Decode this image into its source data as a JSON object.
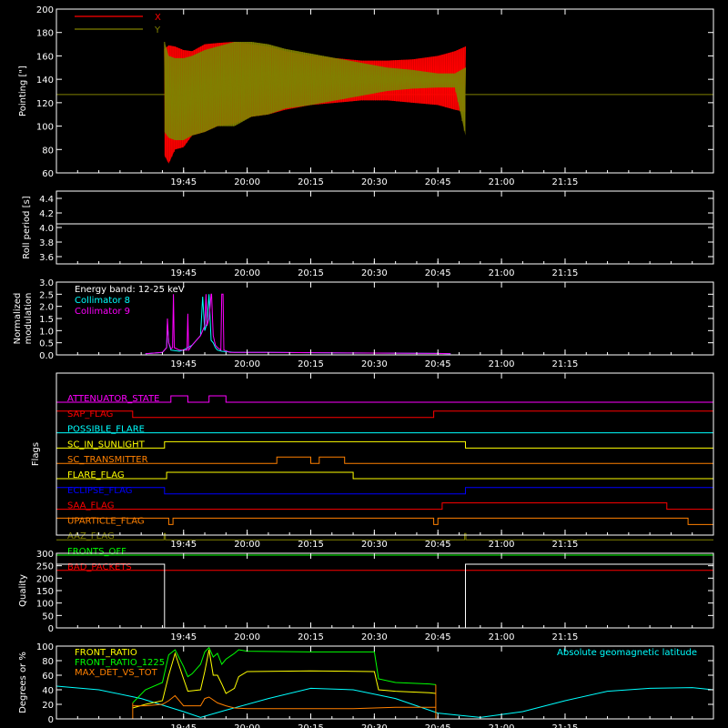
{
  "time_axis": {
    "range_min": [
      -30,
      125
    ],
    "tick_labels": [
      "19:45",
      "20:00",
      "20:15",
      "20:30",
      "20:45",
      "21:00",
      "21:15"
    ],
    "tick_values_min": [
      0,
      15,
      30,
      45,
      60,
      75,
      90
    ]
  },
  "colors": {
    "background": "#000000",
    "axes": "#ffffff",
    "red": "#ff0000",
    "olive": "#808000",
    "cyan": "#00ffff",
    "magenta": "#ff00ff",
    "yellow": "#ffff00",
    "green": "#00ff00",
    "orange": "#ff8000",
    "blue": "#0000ff"
  },
  "chart_data": [
    {
      "id": "pointing",
      "type": "line",
      "ylabel": "Pointing [\"]",
      "ylim": [
        60,
        200
      ],
      "ytick_labels": [
        "60",
        "80",
        "100",
        "120",
        "140",
        "160",
        "180",
        "200"
      ],
      "legend": [
        {
          "name": "X",
          "color": "#ff0000"
        },
        {
          "name": "Y",
          "color": "#808000"
        }
      ],
      "reference_line": 127,
      "series": [
        {
          "name": "X",
          "color": "#ff0000",
          "x": [
            -4.5,
            -3.5,
            -2,
            0,
            2,
            5,
            8,
            12,
            16,
            20,
            24,
            30,
            36,
            42,
            48,
            54,
            60,
            62,
            64,
            66.5
          ],
          "upper": [
            166,
            169,
            168,
            165,
            164,
            170,
            171,
            172,
            170,
            168,
            164,
            160,
            158,
            156,
            156,
            157,
            160,
            162,
            164,
            168
          ],
          "lower": [
            75,
            68,
            80,
            82,
            92,
            95,
            100,
            102,
            108,
            110,
            114,
            118,
            120,
            122,
            122,
            120,
            118,
            116,
            114,
            112
          ]
        },
        {
          "name": "Y",
          "color": "#808000",
          "x": [
            -4.5,
            -3.5,
            -2,
            0,
            2,
            5,
            8,
            12,
            16,
            20,
            24,
            30,
            36,
            42,
            48,
            54,
            60,
            62,
            64,
            66.5
          ],
          "upper": [
            172,
            160,
            158,
            158,
            160,
            165,
            168,
            172,
            172,
            170,
            166,
            162,
            158,
            154,
            150,
            148,
            145,
            145,
            145,
            150
          ],
          "lower": [
            95,
            90,
            88,
            88,
            92,
            95,
            100,
            100,
            108,
            110,
            115,
            118,
            122,
            126,
            130,
            132,
            133,
            133,
            133,
            92
          ]
        }
      ]
    },
    {
      "id": "roll-period",
      "type": "line",
      "ylabel": "Roll period [s]",
      "ylim": [
        3.5,
        4.5
      ],
      "ytick_labels": [
        "3.6",
        "3.8",
        "4.0",
        "4.2",
        "4.4"
      ],
      "series": [
        {
          "color": "#ffffff",
          "x": [
            -30,
            125
          ],
          "y": [
            4.05,
            4.05
          ]
        }
      ]
    },
    {
      "id": "modulation",
      "type": "line",
      "ylabel": "Normalized modulation",
      "ylim": [
        0,
        3
      ],
      "ytick_labels": [
        "0.0",
        "0.5",
        "1.0",
        "1.5",
        "2.0",
        "2.5",
        "3.0"
      ],
      "annotations": [
        "Energy band: 12-25 keV"
      ],
      "legend": [
        {
          "name": "Collimator 8",
          "color": "#00ffff"
        },
        {
          "name": "Collimator 9",
          "color": "#ff00ff"
        }
      ],
      "series": [
        {
          "name": "Collimator 8",
          "color": "#00ffff",
          "x": [
            -9,
            -5,
            -4,
            -3.8,
            -3.5,
            -3,
            -1,
            0,
            2,
            4,
            4.5,
            5,
            5.5,
            6,
            6.5,
            7,
            7.5,
            8,
            9,
            12,
            20,
            40,
            60,
            63
          ],
          "y": [
            0.05,
            0.1,
            0.3,
            1.3,
            0.5,
            0.2,
            0.15,
            0.2,
            0.4,
            0.8,
            2.4,
            1.0,
            1.3,
            2.5,
            0.6,
            0.5,
            0.3,
            0.2,
            0.15,
            0.1,
            0.1,
            0.08,
            0.06,
            0.05
          ]
        },
        {
          "name": "Collimator 9",
          "color": "#ff00ff",
          "x": [
            -9,
            -5,
            -4,
            -3.8,
            -3.5,
            -3,
            -2.6,
            -2.4,
            -2.2,
            -1,
            0.8,
            1,
            1.2,
            2,
            4,
            5,
            5.3,
            5.5,
            6,
            6.5,
            6.6,
            7,
            7.5,
            8,
            8.8,
            9,
            9.3,
            9.5,
            11,
            20,
            40,
            60,
            63
          ],
          "y": [
            0.05,
            0.1,
            0.3,
            1.5,
            0.5,
            0.25,
            0.3,
            2.5,
            0.3,
            0.2,
            0.2,
            1.7,
            0.2,
            0.4,
            0.8,
            1.2,
            2.5,
            1.2,
            1.5,
            2.5,
            2.5,
            0.8,
            0.4,
            0.3,
            0.2,
            2.5,
            2.5,
            0.2,
            0.1,
            0.1,
            0.08,
            0.06,
            0.05
          ]
        }
      ]
    },
    {
      "id": "flags",
      "type": "line",
      "ylabel": "Flags",
      "flags": [
        {
          "name": "ATTENUATOR_STATE",
          "color": "#ff00ff",
          "high": [
            [
              -3,
              1
            ],
            [
              6,
              10
            ]
          ]
        },
        {
          "name": "SAP_FLAG",
          "color": "#ff0000",
          "high": [
            [
              -30,
              -12
            ],
            [
              59,
              125
            ]
          ]
        },
        {
          "name": "POSSIBLE_FLARE",
          "color": "#00ffff",
          "high": []
        },
        {
          "name": "SC_IN_SUNLIGHT",
          "color": "#ffff00",
          "high": [
            [
              -4.5,
              66.5
            ]
          ]
        },
        {
          "name": "SC_TRANSMITTER",
          "color": "#ff8000",
          "high": [
            [
              22,
              30
            ],
            [
              32,
              38
            ]
          ]
        },
        {
          "name": "FLARE_FLAG",
          "color": "#ffff00",
          "high": [
            [
              -4,
              40
            ]
          ]
        },
        {
          "name": "ECLIPSE_FLAG",
          "color": "#0000ff",
          "high": [
            [
              -30,
              -4.5
            ],
            [
              66.5,
              125
            ]
          ]
        },
        {
          "name": "SAA_FLAG",
          "color": "#ff0000",
          "high": [
            [
              61,
              114
            ]
          ]
        },
        {
          "name": "UPARTICLE_FLAG",
          "color": "#ff8000",
          "high": [
            [
              -30,
              -3.5
            ],
            [
              -2.5,
              59
            ],
            [
              60,
              119
            ]
          ]
        },
        {
          "name": "AAZ_FLAG",
          "color": "#808000",
          "high": [
            [
              -4.6,
              -4.3
            ],
            [
              66.3,
              66.6
            ]
          ]
        },
        {
          "name": "FRONTS_OFF",
          "color": "#00ff00",
          "high": []
        },
        {
          "name": "BAD_PACKETS",
          "color": "#ff0000",
          "high": []
        }
      ]
    },
    {
      "id": "quality",
      "type": "line",
      "ylabel": "Quality",
      "ylim": [
        0,
        300
      ],
      "ytick_labels": [
        "0",
        "50",
        "100",
        "150",
        "200",
        "250",
        "300"
      ],
      "series": [
        {
          "color": "#ffffff",
          "x": [
            -30,
            -4.5,
            -4.5,
            66.5,
            66.5,
            125
          ],
          "y": [
            256,
            256,
            0,
            0,
            256,
            256
          ]
        }
      ]
    },
    {
      "id": "ratios",
      "type": "line",
      "ylabel": "Degrees or %",
      "ylim": [
        0,
        100
      ],
      "ytick_labels": [
        "0",
        "20",
        "40",
        "60",
        "80",
        "100"
      ],
      "legend": [
        {
          "name": "FRONT_RATIO",
          "color": "#ffff00"
        },
        {
          "name": "FRONT_RATIO_1225",
          "color": "#00ff00"
        },
        {
          "name": "MAX_DET_VS_TOT",
          "color": "#ff8000"
        }
      ],
      "annotations": [
        "Absolute geomagnetic latitude"
      ],
      "series": [
        {
          "name": "Absolute geomagnetic latitude",
          "color": "#00ffff",
          "x": [
            -30,
            -20,
            -10,
            0,
            4,
            10,
            20,
            30,
            40,
            50,
            55,
            60,
            70,
            80,
            90,
            100,
            110,
            120,
            125
          ],
          "y": [
            45,
            40,
            28,
            10,
            2,
            12,
            28,
            42,
            40,
            28,
            18,
            8,
            2,
            10,
            25,
            38,
            42,
            43,
            40
          ]
        },
        {
          "name": "FRONT_RATIO_1225",
          "color": "#00ff00",
          "x": [
            -12,
            -9,
            -5,
            -3.5,
            -2,
            0,
            1,
            2,
            4,
            5,
            6,
            7,
            8,
            9,
            10,
            12,
            13,
            15,
            30,
            45,
            46,
            50,
            58,
            59.5
          ],
          "y": [
            22,
            40,
            50,
            88,
            95,
            72,
            58,
            62,
            75,
            92,
            98,
            85,
            90,
            75,
            82,
            90,
            95,
            93,
            92,
            92,
            55,
            50,
            48,
            47
          ]
        },
        {
          "name": "FRONT_RATIO",
          "color": "#ffff00",
          "x": [
            -12,
            -9,
            -5,
            -3.5,
            -2,
            0,
            1,
            4,
            5,
            6,
            7,
            8,
            9,
            10,
            12,
            13,
            15,
            30,
            45,
            46,
            50,
            58,
            59.5
          ],
          "y": [
            15,
            20,
            25,
            60,
            90,
            55,
            38,
            40,
            65,
            95,
            60,
            60,
            48,
            35,
            42,
            58,
            65,
            66,
            65,
            40,
            38,
            36,
            35
          ]
        },
        {
          "name": "MAX_DET_VS_TOT",
          "color": "#ff8000",
          "x": [
            -12,
            -9,
            -5,
            -3.5,
            -2,
            0,
            4,
            5,
            6,
            8,
            10,
            12,
            15,
            20,
            30,
            40,
            50,
            59.5
          ],
          "y": [
            18,
            18,
            20,
            25,
            32,
            18,
            18,
            28,
            30,
            22,
            18,
            15,
            14,
            14,
            14,
            14,
            16,
            16
          ]
        }
      ]
    }
  ]
}
